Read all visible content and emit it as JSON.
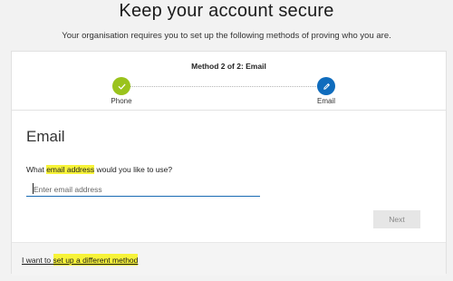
{
  "header": {
    "title": "Keep your account secure",
    "subtitle": "Your organisation requires you to set up the following methods of proving who you are."
  },
  "progress": {
    "method_label": "Method 2 of 2: Email",
    "steps": [
      {
        "label": "Phone",
        "status": "complete",
        "icon": "check-icon",
        "color": "#9ac31c"
      },
      {
        "label": "Email",
        "status": "current",
        "icon": "pencil-icon",
        "color": "#0f6cbd"
      }
    ]
  },
  "form": {
    "heading": "Email",
    "question_prefix": "What ",
    "question_highlight": "email address",
    "question_suffix": " would you like to use?",
    "email_placeholder": "Enter email address",
    "email_value": "",
    "next_label": "Next"
  },
  "footer": {
    "link_prefix": "I want to ",
    "link_highlight": "set up a different method"
  },
  "colors": {
    "highlight": "#f7f339",
    "accent": "#0f6cbd",
    "success": "#9ac31c"
  }
}
